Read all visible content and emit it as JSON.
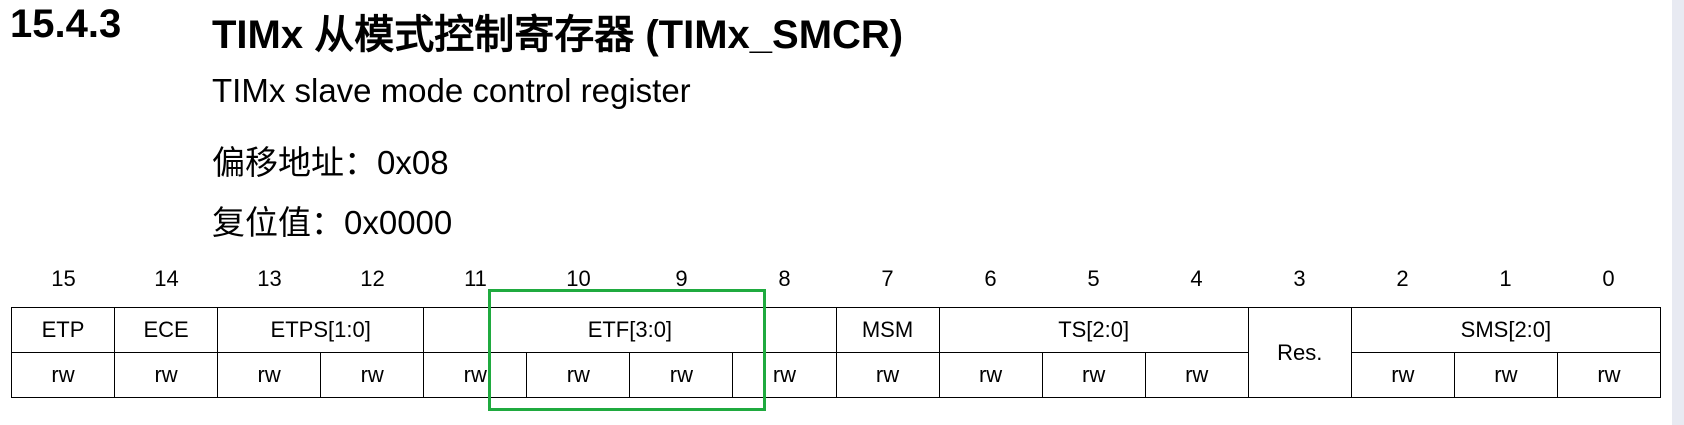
{
  "heading": {
    "number": "15.4.3",
    "title": "TIMx 从模式控制寄存器 (TIMx_SMCR)"
  },
  "subtitle": "TIMx slave mode control register",
  "offset": "偏移地址：0x08",
  "reset": "复位值：0x0000",
  "bit_numbers": [
    "15",
    "14",
    "13",
    "12",
    "11",
    "10",
    "9",
    "8",
    "7",
    "6",
    "5",
    "4",
    "3",
    "2",
    "1",
    "0"
  ],
  "fields": [
    {
      "name": "ETP",
      "bits": 1
    },
    {
      "name": "ECE",
      "bits": 1
    },
    {
      "name": "ETPS[1:0]",
      "bits": 2
    },
    {
      "name": "ETF[3:0]",
      "bits": 4
    },
    {
      "name": "MSM",
      "bits": 1
    },
    {
      "name": "TS[2:0]",
      "bits": 3
    },
    {
      "name": "Res.",
      "bits": 1
    },
    {
      "name": "SMS[2:0]",
      "bits": 3
    }
  ],
  "access": [
    "rw",
    "rw",
    "rw",
    "rw",
    "rw",
    "rw",
    "rw",
    "rw",
    "rw",
    "rw",
    "rw",
    "rw",
    "",
    "rw",
    "rw",
    "rw"
  ],
  "colors": {
    "highlight": "#1faa3f",
    "page_edge": "#e8eaf2"
  }
}
